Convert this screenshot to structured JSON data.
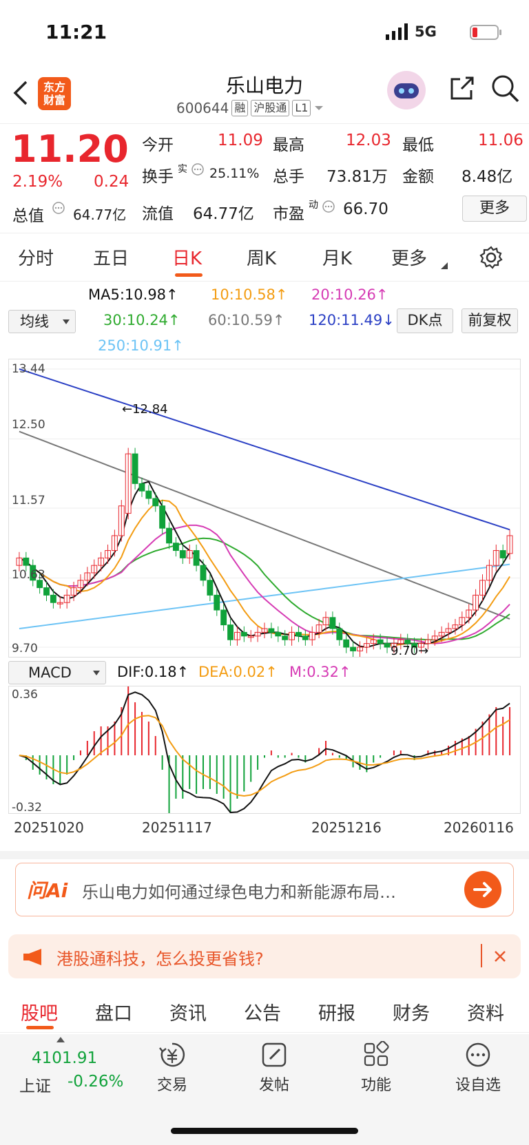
{
  "status_bar": {
    "time": "11:21",
    "network": "5G"
  },
  "header": {
    "title": "乐山电力",
    "code": "600644",
    "tags": [
      "融",
      "沪股通",
      "L1"
    ],
    "logo_text": "东方财富"
  },
  "quote": {
    "price": "11.20",
    "change_pct": "2.19%",
    "change": "0.24",
    "total_value_label": "总值",
    "total_value": "64.77亿",
    "open_label": "今开",
    "open": "11.09",
    "high_label": "最高",
    "high": "12.03",
    "low_label": "最低",
    "low": "11.06",
    "turnover_label": "换手",
    "turnover_sup": "实",
    "turnover": "25.11%",
    "volume_label": "总手",
    "volume": "73.81万",
    "amount_label": "金额",
    "amount": "8.48亿",
    "float_value_label": "流值",
    "float_value": "64.77亿",
    "pe_label": "市盈",
    "pe_sup": "动",
    "pe": "66.70",
    "more_label": "更多"
  },
  "chart_tabs": [
    "分时",
    "五日",
    "日K",
    "周K",
    "月K",
    "更多"
  ],
  "active_tab": "日K",
  "ma_legend": {
    "ma5": "MA5:10.98↑",
    "ma10": "10:10.58↑",
    "ma20": "20:10.26↑",
    "ma30": "30:10.24↑",
    "ma60": "60:10.59↑",
    "ma120": "120:11.49↓",
    "ma250": "250:10.91↑",
    "selector": "均线",
    "dk_label": "DK点",
    "adjust_label": "前复权"
  },
  "colors": {
    "up": "#e8262d",
    "down": "#10a23a",
    "ma5": "#111111",
    "ma10": "#f39c12",
    "ma20": "#d63bb4",
    "ma30": "#2eaa2e",
    "ma60": "#777777",
    "ma120": "#2a3fc4",
    "ma250": "#6cc3f5"
  },
  "chart_data": {
    "type": "candlestick",
    "y_axis_ticks": [
      "13.44",
      "12.50",
      "11.57",
      "10.63",
      "9.70"
    ],
    "ylim": [
      9.7,
      13.44
    ],
    "annotations": [
      "←12.84",
      "9.70→"
    ],
    "x_labels": [
      "20251020",
      "20251117",
      "20251216",
      "20260116"
    ],
    "close": [
      10.9,
      10.8,
      10.6,
      10.5,
      10.4,
      10.3,
      10.3,
      10.4,
      10.5,
      10.6,
      10.7,
      10.8,
      10.9,
      11.0,
      11.2,
      11.6,
      12.3,
      11.9,
      11.8,
      11.7,
      11.6,
      11.3,
      11.1,
      11.0,
      10.9,
      11.0,
      10.8,
      10.6,
      10.4,
      10.2,
      10.0,
      9.8,
      9.9,
      9.85,
      9.85,
      9.9,
      9.95,
      9.9,
      9.85,
      9.8,
      9.9,
      9.85,
      9.8,
      9.9,
      10.0,
      10.1,
      9.95,
      9.8,
      9.7,
      9.65,
      9.7,
      9.75,
      9.8,
      9.75,
      9.7,
      9.75,
      9.8,
      9.75,
      9.7,
      9.75,
      9.8,
      9.85,
      9.9,
      9.95,
      10.0,
      10.1,
      10.2,
      10.4,
      10.6,
      10.8,
      11.0,
      10.9,
      11.2
    ],
    "open": [
      10.8,
      10.9,
      10.8,
      10.6,
      10.5,
      10.4,
      10.3,
      10.3,
      10.4,
      10.5,
      10.6,
      10.7,
      10.8,
      10.9,
      11.0,
      11.2,
      11.5,
      12.3,
      11.9,
      11.8,
      11.7,
      11.6,
      11.3,
      11.1,
      11.0,
      10.9,
      11.0,
      10.8,
      10.6,
      10.4,
      10.2,
      10.0,
      9.8,
      9.9,
      9.85,
      9.85,
      9.9,
      9.95,
      9.9,
      9.85,
      9.8,
      9.9,
      9.85,
      9.8,
      9.9,
      10.0,
      10.1,
      9.95,
      9.8,
      9.7,
      9.65,
      9.7,
      9.75,
      9.8,
      9.75,
      9.7,
      9.75,
      9.8,
      9.75,
      9.7,
      9.75,
      9.8,
      9.85,
      9.9,
      9.95,
      10.0,
      10.1,
      10.2,
      10.4,
      10.6,
      10.8,
      11.0,
      10.96
    ],
    "macd_labels": {
      "ylim_top": "0.36",
      "ylim_bottom": "-0.32"
    }
  },
  "macd_legend": {
    "selector": "MACD",
    "dif": "DIF:0.18↑",
    "dea": "DEA:0.02↑",
    "m": "M:0.32↑"
  },
  "ai_bar": {
    "brand": "问Ai",
    "prompt": "乐山电力如何通过绿色电力和新能源布局…"
  },
  "notice": {
    "text": "港股通科技，怎么投更省钱?"
  },
  "bottom_tabs": [
    "股吧",
    "盘口",
    "资讯",
    "公告",
    "研报",
    "财务",
    "资料"
  ],
  "dock": {
    "index_value": "4101.91",
    "index_name": "上证",
    "index_change": "-0.26%",
    "items": [
      "交易",
      "发帖",
      "功能",
      "设自选"
    ]
  }
}
